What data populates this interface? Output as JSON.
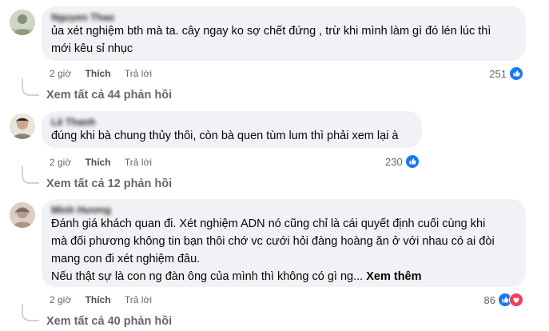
{
  "comments": [
    {
      "author": "Nguyen Thao",
      "text": "ủa xét nghiệm bth mà ta. cây ngay ko sợ chết đứng , trừ khi mình làm gì đó lén lúc thì\nmới kêu sỉ nhục",
      "time": "2 giờ",
      "like": "Thích",
      "reply": "Trả lời",
      "reaction_count": "251",
      "reactions": [
        "like"
      ],
      "view_replies": "Xem tất cả 44 phản hồi"
    },
    {
      "author": "Lê Thanh",
      "text": "đúng khi bà chung thủy thôi, còn bà quen tùm lum thì phải xem lại à",
      "time": "2 giờ",
      "like": "Thích",
      "reply": "Trả lời",
      "reaction_count": "230",
      "reactions": [
        "like"
      ],
      "view_replies": "Xem tất cả 12 phản hồi"
    },
    {
      "author": "Minh Hương",
      "text": "Đánh giá khách quan đi. Xét nghiệm ADN nó cũng chỉ là cái quyết định cuối cùng khi\nmà đối phương không tin bạn thôi chớ vc cưới hỏi đàng hoàng ăn ở với nhau có ai đòi\nmang con đi xét nghiệm đâu.\nNếu thật sự là con ng đàn ông của mình thì không có gì ng...",
      "see_more": "Xem thêm",
      "time": "2 giờ",
      "like": "Thích",
      "reply": "Trả lời",
      "reaction_count": "86",
      "reactions": [
        "like",
        "love"
      ],
      "view_replies": "Xem tất cả 40 phản hồi"
    }
  ],
  "colors": {
    "bubble": "#f0f2f5",
    "like_blue": "#1877f2",
    "love_red": "#f33e58",
    "secondary_text": "#65676b"
  }
}
